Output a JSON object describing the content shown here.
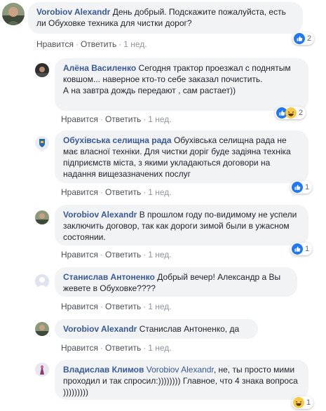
{
  "labels": {
    "like": "Нравится",
    "reply": "Ответить",
    "sep": "·"
  },
  "comments": [
    {
      "author": "Vorobiov Alexandr",
      "text": "День добрый. Подскажите пожалуйста, есть ли Обуховке техника для чистки дорог?",
      "time": "1 нед.",
      "reactions": [
        "like"
      ],
      "reaction_count": "2"
    },
    {
      "author": "Алёна Василенко",
      "text": "Сегодня трактор проезжал с поднятым ковшом... наверное кто-то себе заказал почистить.",
      "text2": "А на завтра дождь передают , сам растает))",
      "time": "1 нед.",
      "reactions": [
        "like",
        "haha"
      ],
      "reaction_count": "2"
    },
    {
      "author": "Обухівська селищна рада",
      "text": "Обухівська селищна рада не має власної техніки. Для чистки доріг буде задіяна техніка підприємств міста, з якими укладаються договори на надання вищезазначених послуг",
      "time": "1 нед.",
      "reactions": [
        "like"
      ],
      "reaction_count": "1"
    },
    {
      "author": "Vorobiov Alexandr",
      "text": "В прошлом году по-видимому не успели заключить договор, так как дороги зимой были в ужасном состоянии.",
      "time": "1 нед.",
      "reactions": [
        "like"
      ],
      "reaction_count": "1"
    },
    {
      "author": "Станислав Антоненко",
      "text": "Добрый вечер! Александр а Вы жевете в Обуховке????",
      "time": "1 нед."
    },
    {
      "author": "Vorobiov Alexandr",
      "text": "Станислав Антоненко, да",
      "time": "1 нед."
    },
    {
      "author": "Владислав Климов",
      "mention": "Vorobiov Alexandr",
      "text": "не, ты просто мими проходил и так спросил:)))))))) Главное, что 4 знака вопроса )))))))))",
      "time": "",
      "reactions": [
        "haha"
      ],
      "reaction_count": "1"
    }
  ],
  "colors": {
    "author": "#385898",
    "bubble": "#f2f3f5",
    "like_blue": "#2078f4",
    "haha_yellow": "#f7c948"
  }
}
